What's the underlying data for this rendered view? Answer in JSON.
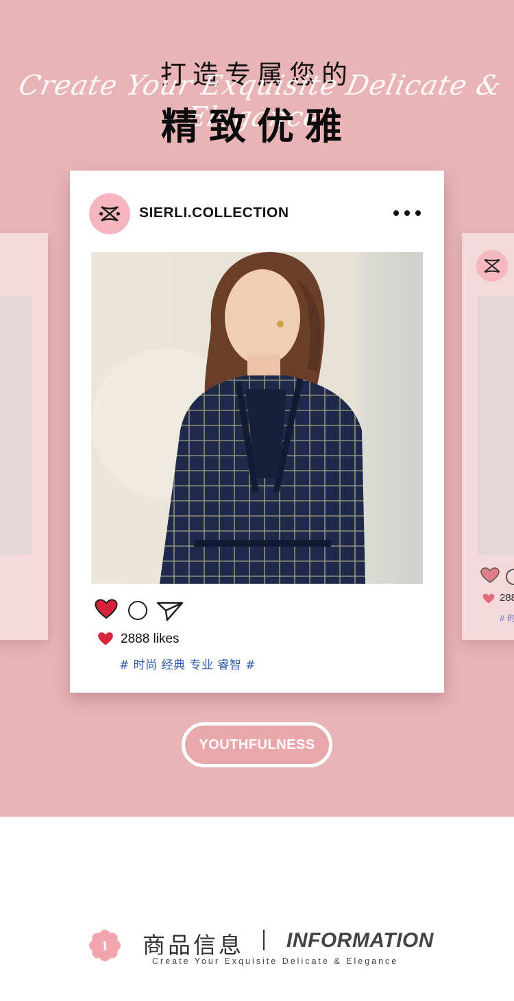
{
  "header": {
    "cn_line1": "打造专属您的",
    "script_line": "Create Your Exquisite Delicate & Elegance",
    "cn_line2": "精致优雅"
  },
  "post": {
    "username": "SIERLI.COLLECTION",
    "likes_text": "2888 likes",
    "hashtags": "# 时尚 经典 专业 睿智 #",
    "avatar_icon": "monogram-logo-icon",
    "more_icon": "more-dots-icon",
    "like_icon": "heart-icon",
    "comment_icon": "comment-icon",
    "share_icon": "send-icon"
  },
  "side_card": {
    "likes_partial": "288",
    "tag_partial": "# 时"
  },
  "badge": {
    "label": "YOUTHFULNESS"
  },
  "info": {
    "number": "1",
    "title_cn": "商品信息",
    "title_en": "INFORMATION",
    "subtitle": "Create Your Exquisite Delicate & Elegance"
  },
  "colors": {
    "hero_bg": "#e8b4b6",
    "card_bg": "#ffffff",
    "heart_red": "#d8233d",
    "tag_blue": "#2b5aa8",
    "pill_bg": "#e8a7ab",
    "avatar_pink": "#f6b6bf"
  }
}
